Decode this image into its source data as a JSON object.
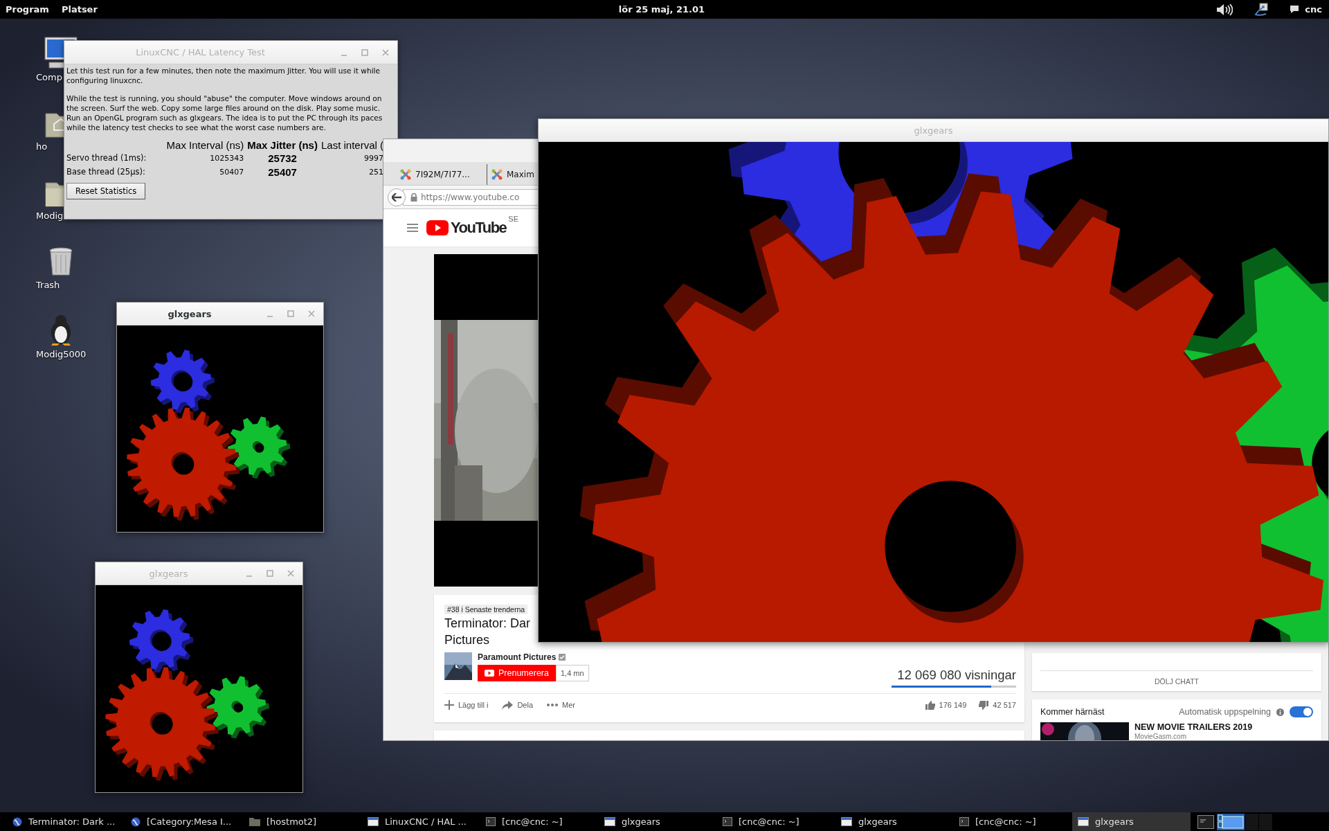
{
  "top_bar": {
    "menus": [
      "Program",
      "Platser"
    ],
    "clock": "lör 25 maj, 21.01",
    "user": "cnc"
  },
  "desktop_icons": [
    {
      "label": "Comp",
      "kind": "computer"
    },
    {
      "label": "ho",
      "kind": "home"
    },
    {
      "label": "Modig",
      "kind": "folder"
    },
    {
      "label": "Trash",
      "kind": "trash"
    },
    {
      "label": "Modig5000",
      "kind": "penguin"
    }
  ],
  "latency_window": {
    "title": "LinuxCNC / HAL Latency Test",
    "active": false,
    "intro": "Let this test run for a few minutes, then note the maximum Jitter.  You will use it while configuring linuxcnc.",
    "details": "While the test is running, you should \"abuse\" the computer. Move windows around on the screen. Surf the web. Copy some large files around on the disk. Play some music. Run an OpenGL program such as glxgears. The idea is to put the PC through its paces while the latency test checks to see what the worst case numbers are.",
    "columns": [
      "Max Interval (ns)",
      "Max Jitter (ns)",
      "Last interval ("
    ],
    "rows": [
      {
        "label": "Servo thread (1ms):",
        "max_interval": "1025343",
        "max_jitter": "25732",
        "last_interval": "9997"
      },
      {
        "label": "Base thread (25µs):",
        "max_interval": "50407",
        "max_jitter": "25407",
        "last_interval": "251"
      }
    ],
    "button": "Reset Statistics"
  },
  "gear_windows": [
    {
      "title": "glxgears",
      "active": true
    },
    {
      "title": "glxgears",
      "active": false
    },
    {
      "title": "glxgears",
      "active": false
    }
  ],
  "browser": {
    "tabs": [
      {
        "label": "7I92M/7I77...",
        "selected": false
      },
      {
        "label": "Maxim",
        "selected": false
      }
    ],
    "url": "https://www.youtube.co",
    "logo": "YouTube",
    "region": "SE",
    "trending": "#38 i Senaste trenderna",
    "title_lines": [
      "Terminator: Dar",
      "Pictures"
    ],
    "channel": "Paramount Pictures",
    "subscribe": "Prenumerera",
    "subscribers": "1,4 mn",
    "views": "12 069 080 visningar",
    "like_bar": {
      "level": 0.8
    },
    "actions": [
      "Lägg till i",
      "Dela",
      "Mer"
    ],
    "likes": "176 149",
    "dislikes": "42 517",
    "hide_chat": "DÖLJ CHATT",
    "up_next": {
      "heading": "Kommer härnäst",
      "autoplay_label": "Automatisk uppspelning",
      "autoplay": true,
      "video_title": "NEW MOVIE TRAILERS 2019",
      "video_channel": "MovieGasm.com"
    }
  },
  "taskbar": [
    {
      "label": "Terminator: Dark ...",
      "kind": "browser",
      "selected": false
    },
    {
      "label": "[Category:Mesa I...",
      "kind": "browser",
      "selected": false
    },
    {
      "label": "[hostmot2]",
      "kind": "folder",
      "selected": false
    },
    {
      "label": "LinuxCNC / HAL ...",
      "kind": "window",
      "selected": false
    },
    {
      "label": "[cnc@cnc: ~]",
      "kind": "terminal",
      "selected": false
    },
    {
      "label": "glxgears",
      "kind": "window",
      "selected": false
    },
    {
      "label": "[cnc@cnc: ~]",
      "kind": "terminal",
      "selected": false
    },
    {
      "label": "glxgears",
      "kind": "window",
      "selected": false
    },
    {
      "label": "[cnc@cnc: ~]",
      "kind": "terminal",
      "selected": false
    },
    {
      "label": "glxgears",
      "kind": "window",
      "selected": true
    }
  ]
}
